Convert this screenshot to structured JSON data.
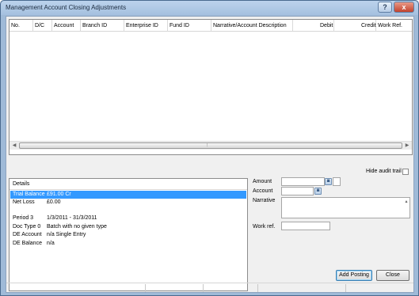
{
  "window": {
    "title": "Management Account Closing Adjustments",
    "help_label": "?",
    "close_label": "x"
  },
  "grid": {
    "columns": [
      "No.",
      "D/C",
      "Account",
      "Branch ID",
      "Enterprise ID",
      "Fund ID",
      "Narrative/Account Description",
      "Debit",
      "Credit",
      "Work Ref."
    ],
    "rows": []
  },
  "hide_audit_trail": {
    "label": "Hide audit trail",
    "checked": false
  },
  "details": {
    "header": "Details",
    "rows": [
      {
        "label": "Trial Balance",
        "value": "£91.00 Cr",
        "selected": true
      },
      {
        "label": "Net Loss",
        "value": "£0.00",
        "selected": false
      },
      {
        "label": "Period 3",
        "value": "1/3/2011 - 31/3/2011",
        "selected": false
      },
      {
        "label": "Doc Type 0",
        "value": "Batch with no given type",
        "selected": false
      },
      {
        "label": "DE Account",
        "value": "n/a Single Entry",
        "selected": false
      },
      {
        "label": "DE Balance",
        "value": "n/a",
        "selected": false
      }
    ]
  },
  "form": {
    "amount_label": "Amount",
    "amount_value": "",
    "account_label": "Account",
    "account_value": "",
    "narrative_label": "Narrative",
    "narrative_value": "",
    "workref_label": "Work ref.",
    "workref_value": ""
  },
  "buttons": {
    "add_posting": "Add Posting",
    "close": "Close"
  },
  "icons": {
    "lookup": "lookup-icon"
  }
}
